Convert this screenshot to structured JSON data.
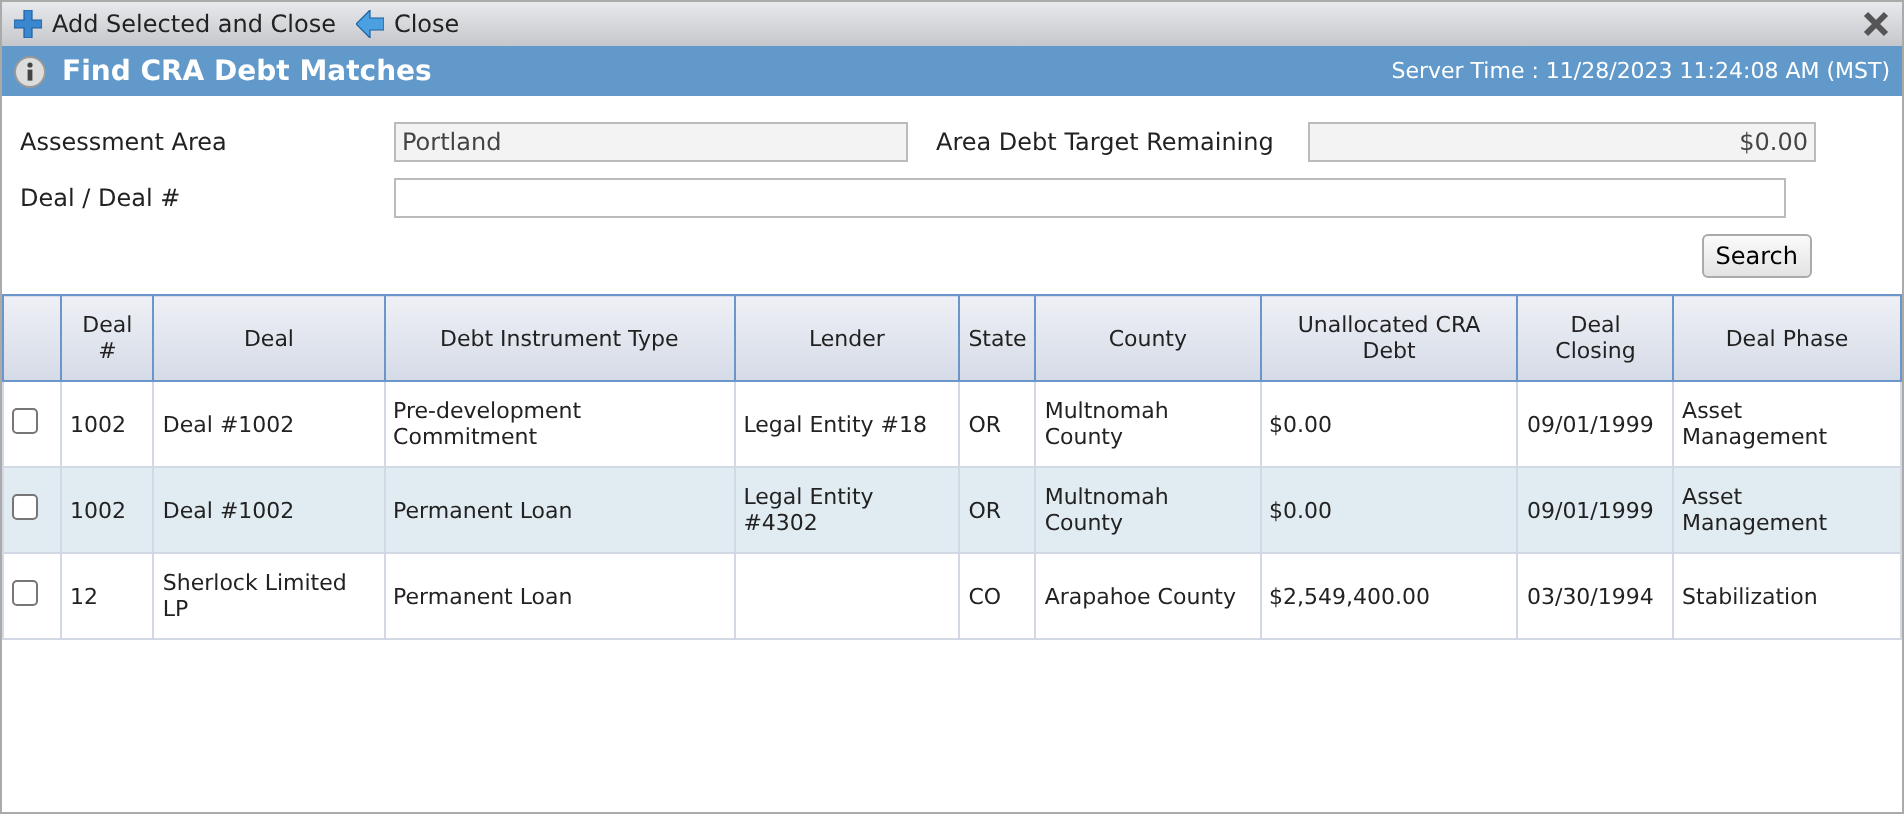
{
  "toolbar": {
    "buttons": [
      {
        "kind": "add",
        "label": "Add Selected and Close"
      },
      {
        "kind": "back",
        "label": "Close"
      }
    ]
  },
  "title_bar": {
    "title": "Find CRA Debt Matches",
    "server_time": "Server Time : 11/28/2023 11:24:08 AM (MST)"
  },
  "form": {
    "assessment_area": {
      "label": "Assessment Area",
      "value": "Portland"
    },
    "area_debt_target_remaining": {
      "label": "Area Debt Target Remaining",
      "value": "$0.00"
    },
    "deal": {
      "label": "Deal / Deal #"
    },
    "search_button": "Search"
  },
  "table": {
    "columns": [
      "Deal #",
      "Deal",
      "Debt Instrument Type",
      "Lender",
      "State",
      "County",
      "Unallocated CRA Debt",
      "Deal Closing",
      "Deal Phase"
    ],
    "rows": [
      {
        "checked": false,
        "cells": [
          "1002",
          "Deal #1002",
          "Pre-development Commitment",
          "Legal Entity #18",
          "OR",
          "Multnomah County",
          "$0.00",
          "09/01/1999",
          "Asset Management"
        ]
      },
      {
        "checked": false,
        "cells": [
          "1002",
          "Deal #1002",
          "Permanent Loan",
          "Legal Entity #4302",
          "OR",
          "Multnomah County",
          "$0.00",
          "09/01/1999",
          "Asset Management"
        ]
      },
      {
        "checked": false,
        "cells": [
          "12",
          "Sherlock Limited LP",
          "Permanent Loan",
          "",
          "CO",
          "Arapahoe County",
          "$2,549,400.00",
          "03/30/1994",
          "Stabilization"
        ]
      }
    ]
  }
}
